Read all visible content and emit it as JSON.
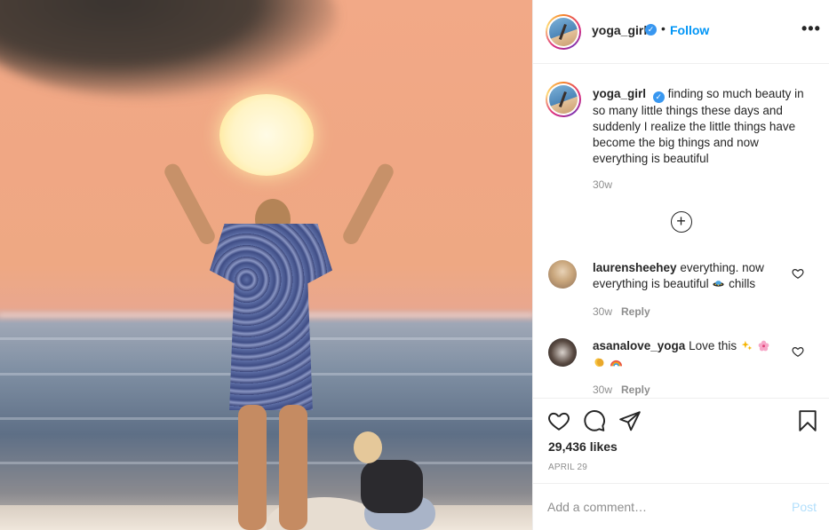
{
  "post": {
    "author": "yoga_girl",
    "follow_label": "Follow",
    "separator": "•",
    "more_label": "•••",
    "verified_mark": "✓"
  },
  "caption": {
    "username": "yoga_girl",
    "text": "finding so much beauty in so many little things these days and suddenly I realize the little things have become the big things and now everything is beautiful",
    "time": "30w"
  },
  "load_more": {
    "icon": "plus-circle-icon",
    "symbol": "+"
  },
  "comments": [
    {
      "username": "laurensheehey",
      "text_before": "everything. now everything is beautiful",
      "emoji": [
        "ufo-icon"
      ],
      "text_after": "chills",
      "time": "30w",
      "reply_label": "Reply"
    },
    {
      "username": "asanalove_yoga",
      "text_before": "Love this",
      "emoji": [
        "sparkles-icon",
        "cherry-blossom-icon",
        "clapping-hands-icon",
        "rainbow-icon"
      ],
      "time": "30w",
      "reply_label": "Reply"
    }
  ],
  "actions": {
    "icons": [
      "heart-icon",
      "comment-icon",
      "share-icon",
      "bookmark-icon"
    ],
    "likes": "29,436 likes",
    "date": "APRIL 29"
  },
  "add_comment": {
    "placeholder": "Add a comment…",
    "post_label": "Post"
  },
  "colors": {
    "link_blue": "#0095f6",
    "post_disabled": "#b2dffc",
    "muted_text": "#8e8e8e",
    "verified_blue": "#3897f0"
  }
}
